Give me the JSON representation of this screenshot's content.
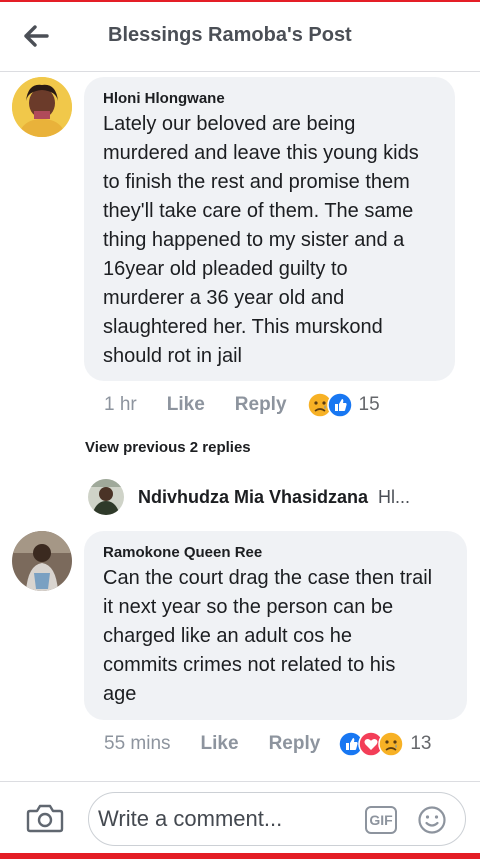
{
  "header": {
    "title": "Blessings Ramoba's Post"
  },
  "comments": [
    {
      "author": "Hloni Hlongwane",
      "lines": [
        "Lately our beloved are being",
        "murdered and leave this young kids",
        "to finish the rest and promise them",
        "they'll take care of them. The same",
        "thing happened to my sister and a",
        "16year old pleaded guilty to",
        "murderer a 36 year old and",
        "slaughtered her. This murskond",
        "should rot in jail"
      ],
      "time": "1 hr",
      "like_label": "Like",
      "reply_label": "Reply",
      "reaction_count": "15",
      "reactions": [
        "sad-reaction",
        "like-reaction"
      ]
    },
    {
      "author": "Ramokone Queen Ree",
      "lines": [
        "Can the court drag the case then trail",
        "it next year so the person can be",
        "charged like an adult cos he",
        "commits crimes not related to his",
        "age"
      ],
      "time": "55 mins",
      "like_label": "Like",
      "reply_label": "Reply",
      "reaction_count": "13",
      "reactions": [
        "like-reaction",
        "love-reaction",
        "sad-reaction"
      ]
    }
  ],
  "replies_thread": {
    "view_previous": "View previous 2 replies",
    "reply_author": "Ndivhudza Mia Vhasidzana",
    "reply_snippet": "Hl..."
  },
  "composer": {
    "placeholder": "Write a comment...",
    "gif_label": "GIF"
  },
  "colors": {
    "accent_red": "#e41e26",
    "bubble_bg": "#f0f2f5",
    "like_blue": "#1877f2",
    "love_red": "#f33e58",
    "sad_yellow": "#f7b125"
  }
}
